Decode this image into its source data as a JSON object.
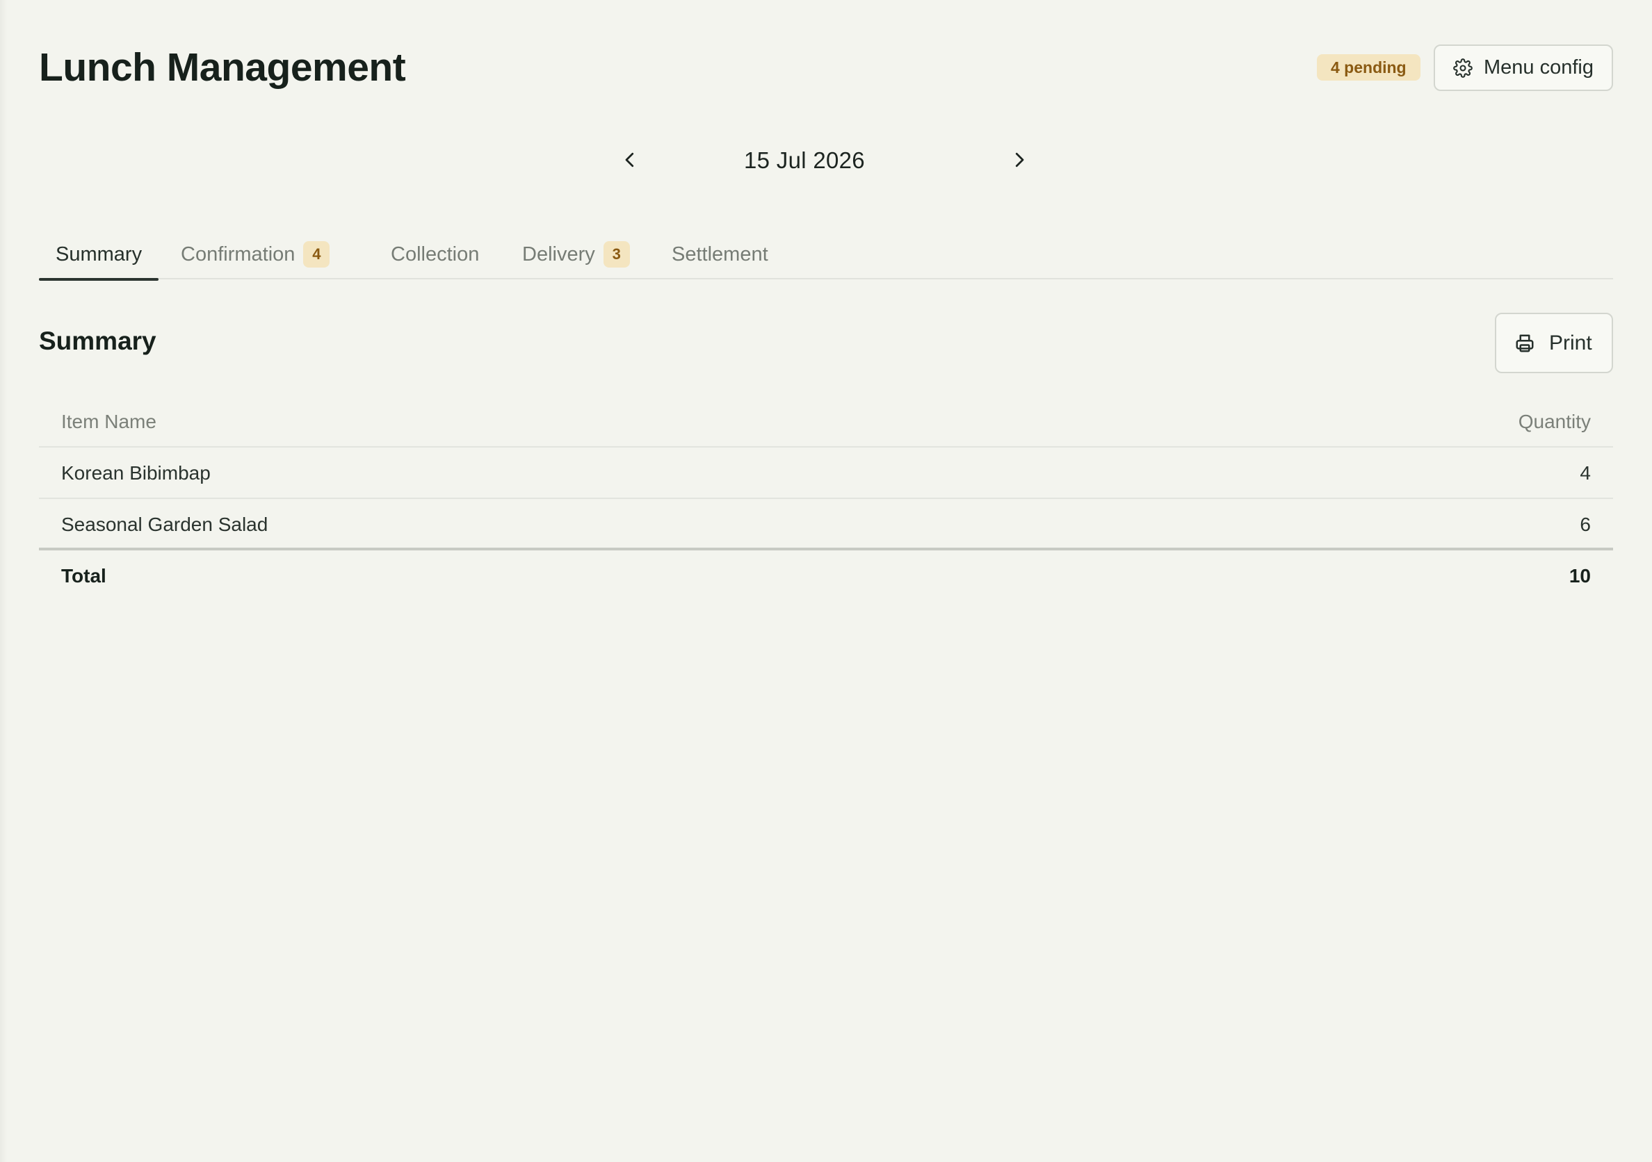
{
  "header": {
    "title": "Lunch Management",
    "pending_badge": "4 pending",
    "menu_config_label": "Menu config"
  },
  "date_nav": {
    "date": "15 Jul 2026"
  },
  "tabs": [
    {
      "label": "Summary",
      "count": null,
      "active": true
    },
    {
      "label": "Confirmation",
      "count": "4",
      "active": false
    },
    {
      "label": "Collection",
      "count": null,
      "active": false
    },
    {
      "label": "Delivery",
      "count": "3",
      "active": false
    },
    {
      "label": "Settlement",
      "count": null,
      "active": false
    }
  ],
  "summary": {
    "title": "Summary",
    "print_label": "Print",
    "columns": {
      "item_name": "Item Name",
      "quantity": "Quantity"
    },
    "rows": [
      {
        "name": "Korean Bibimbap",
        "quantity": "4"
      },
      {
        "name": "Seasonal Garden Salad",
        "quantity": "6"
      }
    ],
    "total": {
      "label": "Total",
      "quantity": "10"
    }
  },
  "colors": {
    "background": "#f3f4ee",
    "badge_bg": "#f4e5c0",
    "badge_text": "#8a5a12",
    "text_primary": "#17211c"
  }
}
